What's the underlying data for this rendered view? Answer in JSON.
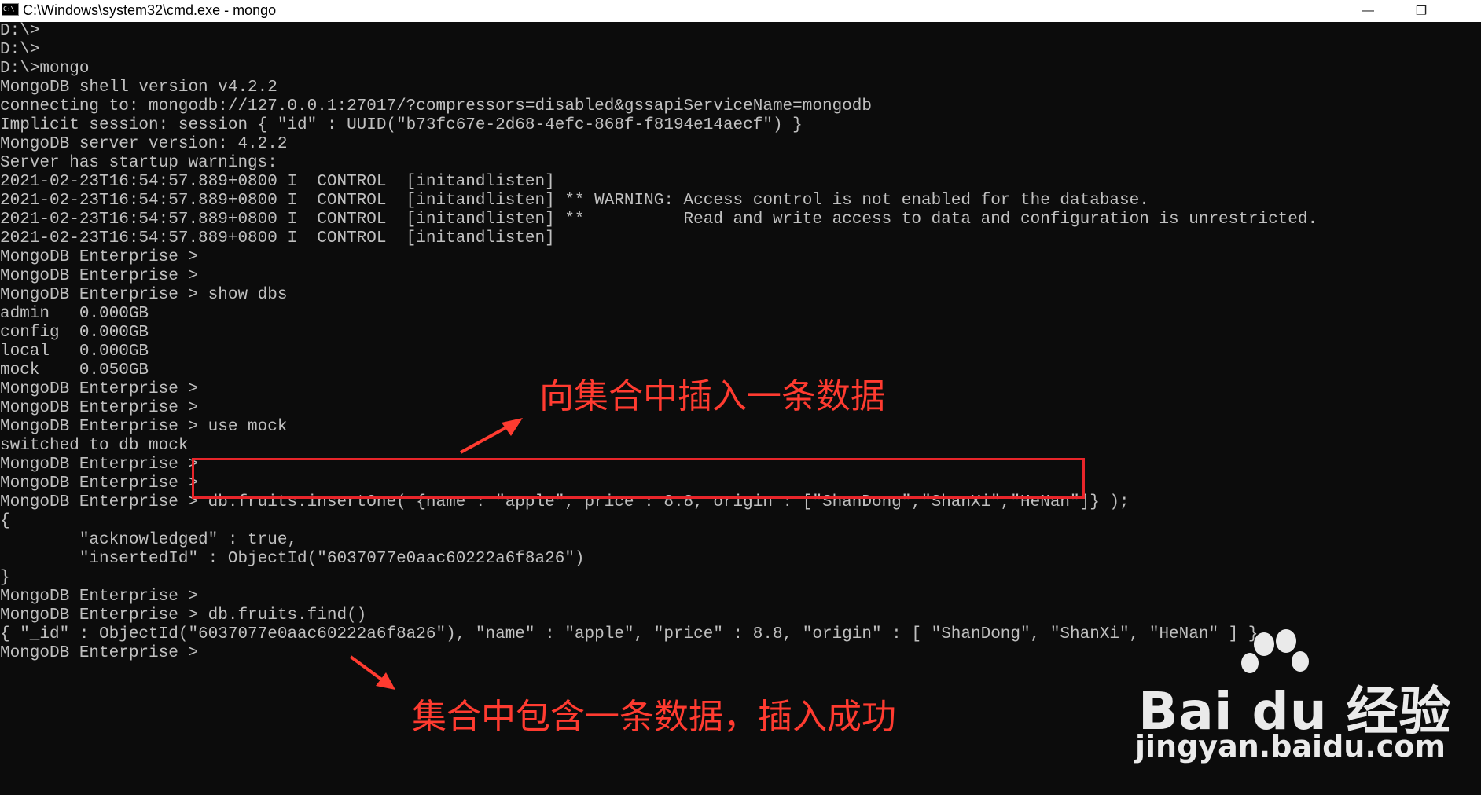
{
  "window": {
    "title": "C:\\Windows\\system32\\cmd.exe - mongo",
    "minimize_glyph": "—",
    "restore_glyph": "❐",
    "icon": "cmd-icon"
  },
  "terminal": {
    "lines": [
      "D:\\>",
      "D:\\>",
      "D:\\>mongo",
      "MongoDB shell version v4.2.2",
      "connecting to: mongodb://127.0.0.1:27017/?compressors=disabled&gssapiServiceName=mongodb",
      "Implicit session: session { \"id\" : UUID(\"b73fc67e-2d68-4efc-868f-f8194e14aecf\") }",
      "MongoDB server version: 4.2.2",
      "Server has startup warnings:",
      "2021-02-23T16:54:57.889+0800 I  CONTROL  [initandlisten]",
      "2021-02-23T16:54:57.889+0800 I  CONTROL  [initandlisten] ** WARNING: Access control is not enabled for the database.",
      "2021-02-23T16:54:57.889+0800 I  CONTROL  [initandlisten] **          Read and write access to data and configuration is unrestricted.",
      "2021-02-23T16:54:57.889+0800 I  CONTROL  [initandlisten]",
      "MongoDB Enterprise >",
      "MongoDB Enterprise >",
      "MongoDB Enterprise > show dbs",
      "admin   0.000GB",
      "config  0.000GB",
      "local   0.000GB",
      "mock    0.050GB",
      "MongoDB Enterprise >",
      "MongoDB Enterprise >",
      "MongoDB Enterprise > use mock",
      "switched to db mock",
      "MongoDB Enterprise >",
      "MongoDB Enterprise >",
      "MongoDB Enterprise > db.fruits.insertOne( {name : \"apple\", price : 8.8, origin : [\"ShanDong\",\"ShanXi\",\"HeNan\"]} );",
      "{",
      "        \"acknowledged\" : true,",
      "        \"insertedId\" : ObjectId(\"6037077e0aac60222a6f8a26\")",
      "}",
      "MongoDB Enterprise >",
      "MongoDB Enterprise > db.fruits.find()",
      "{ \"_id\" : ObjectId(\"6037077e0aac60222a6f8a26\"), \"name\" : \"apple\", \"price\" : 8.8, \"origin\" : [ \"ShanDong\", \"ShanXi\", \"HeNan\" ] }",
      "MongoDB Enterprise >"
    ]
  },
  "annotations": {
    "insert_note": "向集合中插入一条数据",
    "result_note": "集合中包含一条数据，插入成功",
    "color": "#ff3b30"
  },
  "watermark": {
    "logo_text": "Bai du 经验",
    "url": "jingyan.baidu.com"
  },
  "colors": {
    "background": "#0c0c0c",
    "foreground": "#c0c0c0",
    "highlight_box": "#e8252a"
  }
}
